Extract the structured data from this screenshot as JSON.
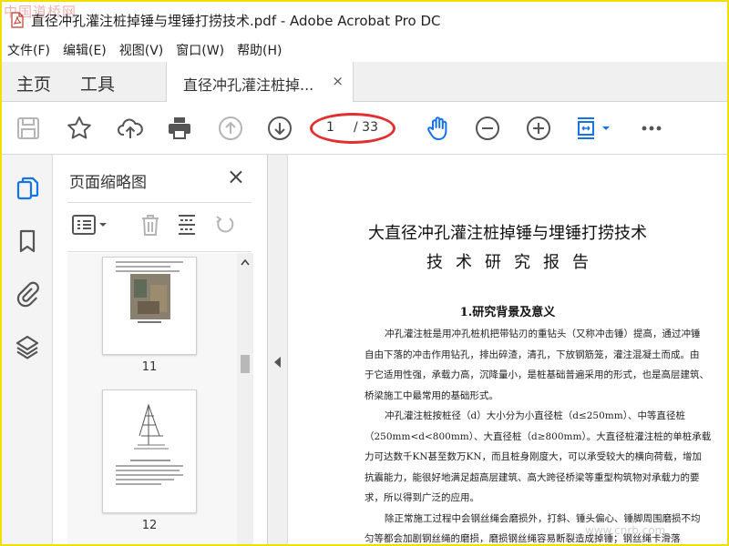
{
  "window": {
    "watermark": "中国道桥网",
    "title": "直径冲孔灌注桩掉锤与埋锤打捞技术.pdf - Adobe Acrobat Pro DC"
  },
  "menu": [
    "文件(F)",
    "编辑(E)",
    "视图(V)",
    "窗口(W)",
    "帮助(H)"
  ],
  "tabs": {
    "home": "主页",
    "tools": "工具",
    "document": "直径冲孔灌注桩掉...",
    "close": "×"
  },
  "toolbar": {
    "icons": [
      "save-icon",
      "star-icon",
      "upload-icon",
      "print-icon",
      "prev-page-icon",
      "next-page-icon",
      "hand-tool-icon",
      "zoom-out-icon",
      "zoom-in-icon",
      "fit-page-icon",
      "more-icon"
    ],
    "page_current": "1",
    "page_total": "/ 33",
    "accent_color": "#1473e6",
    "annotation_color": "#e03030"
  },
  "rail": {
    "icons": [
      "page-thumbnails-icon",
      "bookmark-icon",
      "attachment-icon",
      "layers-icon"
    ]
  },
  "thumbnails_panel": {
    "title": "页面缩略图",
    "close": "×",
    "tools": [
      "thumbnail-options-icon",
      "delete-icon",
      "extract-icon",
      "rotate-icon"
    ],
    "pages": [
      {
        "label": "11"
      },
      {
        "label": "12"
      }
    ]
  },
  "document": {
    "title": "大直径冲孔灌注桩掉锤与埋锤打捞技术",
    "subtitle": "技术研究报告",
    "heading": "1.研究背景及意义",
    "lines": [
      "冲孔灌注桩是用冲孔桩机把带钻刃的重钻头（又称冲击锤）提高，通过冲锤",
      "自由下落的冲击作用钻孔，排出碎渣，清孔，下放钢筋笼，灌注混凝土而成。由",
      "于它适用性强，承载力高，沉降量小，是桩基础普遍采用的形式，也是高层建筑、",
      "桥梁施工中最常用的基础形式。",
      "冲孔灌注桩按桩径（d）大小分为小直径桩（d≤250mm）、中等直径桩",
      "（250mm<d<800mm）、大直径桩（d≥800mm）。大直径桩灌注桩的单桩承载",
      "力可达数千KN甚至数万KN，而且桩身刚度大，可以承受较大的横向荷载，增加",
      "抗震能力，能很好地满足超高层建筑、高大跨径桥梁等重型构筑物对承载力的要",
      "求，所以得到广泛的应用。",
      "除正常施工过程中会钢丝绳会磨损外，打斜、锤头偏心、锤脚周围磨损不均",
      "匀等都会加剧钢丝绳的磨损，磨损钢丝绳容易断裂造成掉锤；钢丝绳卡滑落"
    ],
    "watermark": "www.cnrb.com"
  }
}
